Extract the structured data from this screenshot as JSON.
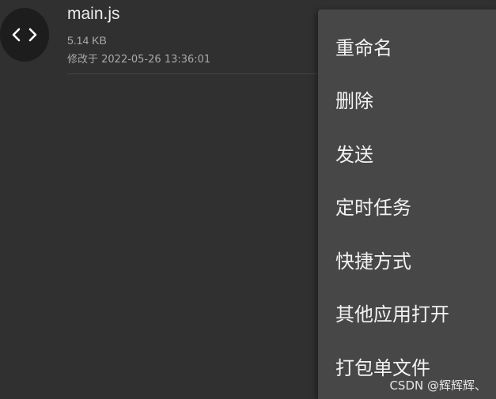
{
  "file": {
    "name": "main.js",
    "size": "5.14 KB",
    "modified": "修改于 2022-05-26 13:36:01",
    "icon": "code-icon"
  },
  "menu": {
    "items": [
      {
        "label": "重命名"
      },
      {
        "label": "删除"
      },
      {
        "label": "发送"
      },
      {
        "label": "定时任务"
      },
      {
        "label": "快捷方式"
      },
      {
        "label": "其他应用打开"
      },
      {
        "label": "打包单文件"
      }
    ]
  },
  "watermark": "CSDN @辉辉辉、",
  "colors": {
    "background": "#303030",
    "menu_background": "#474747",
    "icon_circle": "#1d1d1d",
    "primary_text": "#ececec",
    "secondary_text": "#a9a9a9"
  }
}
